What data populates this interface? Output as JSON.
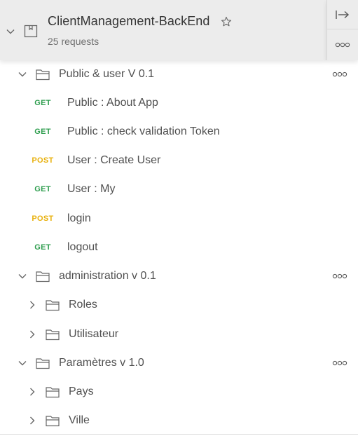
{
  "collection": {
    "title": "ClientManagement-BackEnd",
    "request_count": "25 requests"
  },
  "folders": [
    {
      "name": "Public & user V 0.1",
      "requests": [
        {
          "method": "GET",
          "name": "Public : About App"
        },
        {
          "method": "GET",
          "name": "Public : check validation Token"
        },
        {
          "method": "POST",
          "name": "User : Create User"
        },
        {
          "method": "GET",
          "name": "User : My"
        },
        {
          "method": "POST",
          "name": "login"
        },
        {
          "method": "GET",
          "name": "logout"
        }
      ]
    },
    {
      "name": "administration v 0.1",
      "subfolders": [
        {
          "name": "Roles"
        },
        {
          "name": "Utilisateur"
        }
      ]
    },
    {
      "name": "Paramètres v 1.0",
      "subfolders": [
        {
          "name": "Pays"
        },
        {
          "name": "Ville"
        }
      ]
    }
  ],
  "colors": {
    "get": "#2f9e4f",
    "post": "#e8b10e",
    "header_bg": "#ececec"
  },
  "icons": {
    "collapse": "chevron-down-icon",
    "expand": "chevron-right-icon",
    "folder": "folder-icon",
    "collection": "collection-icon",
    "favorite": "star-icon",
    "toggle_panel": "arrow-right-bar-icon",
    "more": "more-options-icon"
  }
}
